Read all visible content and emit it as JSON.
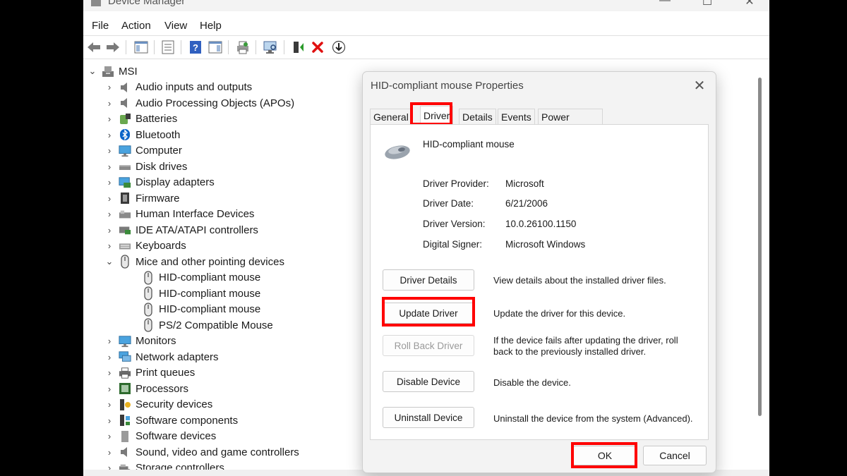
{
  "window": {
    "title": "Device Manager"
  },
  "menu": [
    "File",
    "Action",
    "View",
    "Help"
  ],
  "toolbar_icons": [
    "back-arrow-icon",
    "forward-arrow-icon",
    "show-hide-console-tree-icon",
    "properties-icon",
    "help-icon",
    "action-pane-icon",
    "print-icon",
    "scan-hardware-icon",
    "update-driver-icon",
    "uninstall-icon",
    "enable-device-icon"
  ],
  "tree": {
    "root": "MSI",
    "items": [
      {
        "label": "Audio inputs and outputs",
        "icon": "speaker-icon",
        "expanded": false
      },
      {
        "label": "Audio Processing Objects (APOs)",
        "icon": "speaker-icon",
        "expanded": false
      },
      {
        "label": "Batteries",
        "icon": "battery-icon",
        "expanded": false
      },
      {
        "label": "Bluetooth",
        "icon": "bluetooth-icon",
        "expanded": false
      },
      {
        "label": "Computer",
        "icon": "monitor-icon",
        "expanded": false
      },
      {
        "label": "Disk drives",
        "icon": "disk-icon",
        "expanded": false
      },
      {
        "label": "Display adapters",
        "icon": "display-adapter-icon",
        "expanded": false
      },
      {
        "label": "Firmware",
        "icon": "firmware-icon",
        "expanded": false
      },
      {
        "label": "Human Interface Devices",
        "icon": "hid-icon",
        "expanded": false
      },
      {
        "label": "IDE ATA/ATAPI controllers",
        "icon": "ide-icon",
        "expanded": false
      },
      {
        "label": "Keyboards",
        "icon": "keyboard-icon",
        "expanded": false
      },
      {
        "label": "Mice and other pointing devices",
        "icon": "mouse-icon",
        "expanded": true
      },
      {
        "label": "HID-compliant mouse",
        "icon": "mouse-icon",
        "child": true
      },
      {
        "label": "HID-compliant mouse",
        "icon": "mouse-icon",
        "child": true
      },
      {
        "label": "HID-compliant mouse",
        "icon": "mouse-icon",
        "child": true
      },
      {
        "label": "PS/2 Compatible Mouse",
        "icon": "mouse-icon",
        "child": true
      },
      {
        "label": "Monitors",
        "icon": "monitor-icon",
        "expanded": false
      },
      {
        "label": "Network adapters",
        "icon": "network-icon",
        "expanded": false
      },
      {
        "label": "Print queues",
        "icon": "printer-icon",
        "expanded": false
      },
      {
        "label": "Processors",
        "icon": "processor-icon",
        "expanded": false
      },
      {
        "label": "Security devices",
        "icon": "security-icon",
        "expanded": false
      },
      {
        "label": "Software components",
        "icon": "software-component-icon",
        "expanded": false
      },
      {
        "label": "Software devices",
        "icon": "software-device-icon",
        "expanded": false
      },
      {
        "label": "Sound, video and game controllers",
        "icon": "speaker-icon",
        "expanded": false
      },
      {
        "label": "Storage controllers",
        "icon": "storage-icon",
        "expanded": false
      }
    ]
  },
  "dialog": {
    "title": "HID-compliant mouse Properties",
    "tabs": [
      "General",
      "Driver",
      "Details",
      "Events",
      "Power Management"
    ],
    "active_tab": "Driver",
    "device_name": "HID-compliant mouse",
    "info": [
      {
        "label": "Driver Provider:",
        "value": "Microsoft"
      },
      {
        "label": "Driver Date:",
        "value": "6/21/2006"
      },
      {
        "label": "Driver Version:",
        "value": "10.0.26100.1150"
      },
      {
        "label": "Digital Signer:",
        "value": "Microsoft Windows"
      }
    ],
    "actions": [
      {
        "button": "Driver Details",
        "desc": "View details about the installed driver files.",
        "enabled": true
      },
      {
        "button": "Update Driver",
        "desc": "Update the driver for this device.",
        "enabled": true
      },
      {
        "button": "Roll Back Driver",
        "desc": "If the device fails after updating the driver, roll back to the previously installed driver.",
        "enabled": false
      },
      {
        "button": "Disable Device",
        "desc": "Disable the device.",
        "enabled": true
      },
      {
        "button": "Uninstall Device",
        "desc": "Uninstall the device from the system (Advanced).",
        "enabled": true
      }
    ],
    "ok": "OK",
    "cancel": "Cancel"
  },
  "colors": {
    "highlight": "#ff0000",
    "accent": "#0067c0"
  }
}
